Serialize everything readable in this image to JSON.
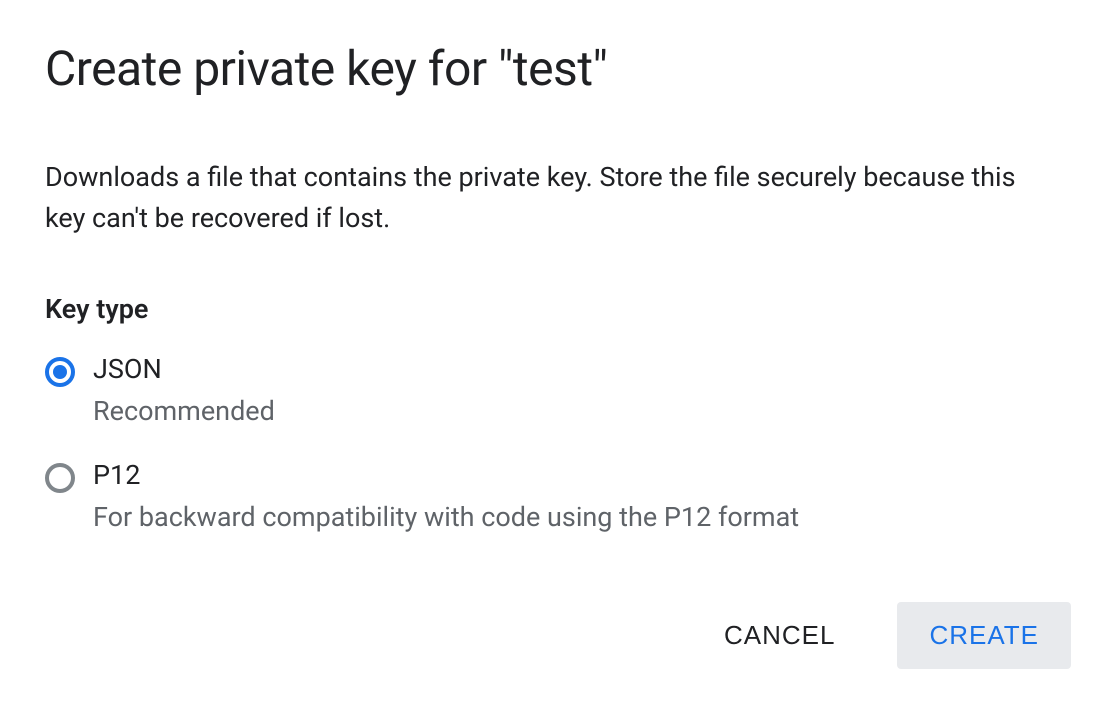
{
  "dialog": {
    "title": "Create private key for \"test\"",
    "description": "Downloads a file that contains the private key. Store the file securely because this key can't be recovered if lost.",
    "sectionLabel": "Key type",
    "options": [
      {
        "label": "JSON",
        "description": "Recommended",
        "selected": true
      },
      {
        "label": "P12",
        "description": "For backward compatibility with code using the P12 format",
        "selected": false
      }
    ],
    "actions": {
      "cancel": "CANCEL",
      "create": "CREATE"
    }
  }
}
